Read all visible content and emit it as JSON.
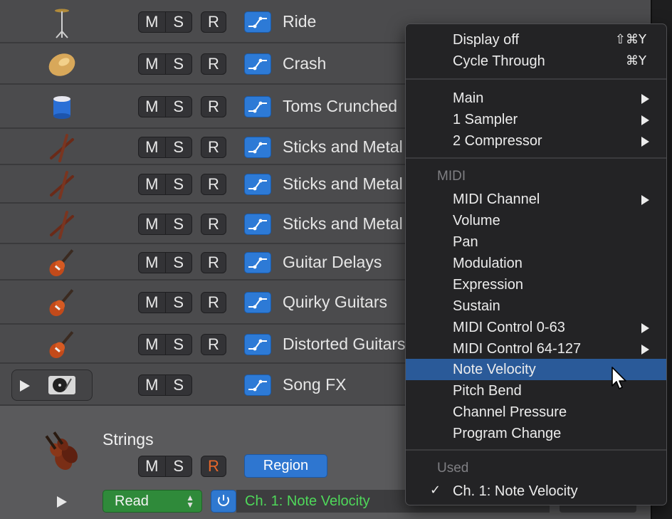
{
  "tracks": [
    {
      "name": "Ride",
      "icon": "cymbal-stand-icon",
      "mute": "M",
      "solo": "S",
      "record": "R"
    },
    {
      "name": "Crash",
      "icon": "crash-cymbal-icon",
      "mute": "M",
      "solo": "S",
      "record": "R"
    },
    {
      "name": "Toms Crunched",
      "icon": "tom-drum-icon",
      "mute": "M",
      "solo": "S",
      "record": "R"
    },
    {
      "name": "Sticks and Metal",
      "icon": "drumsticks-icon",
      "mute": "M",
      "solo": "S",
      "record": "R"
    },
    {
      "name": "Sticks and Metal",
      "icon": "drumsticks-icon",
      "mute": "M",
      "solo": "S",
      "record": "R"
    },
    {
      "name": "Sticks and Metal",
      "icon": "drumsticks-icon",
      "mute": "M",
      "solo": "S",
      "record": "R"
    },
    {
      "name": "Guitar Delays",
      "icon": "electric-guitar-icon",
      "mute": "M",
      "solo": "S",
      "record": "R"
    },
    {
      "name": "Quirky Guitars",
      "icon": "electric-guitar-icon",
      "mute": "M",
      "solo": "S",
      "record": "R"
    },
    {
      "name": "Distorted Guitars",
      "icon": "electric-guitar-icon",
      "mute": "M",
      "solo": "S",
      "record": "R"
    },
    {
      "name": "Song FX",
      "icon": "turntable-icon",
      "mute": "M",
      "solo": "S"
    }
  ],
  "selected_track": {
    "name": "Strings",
    "icon": "violin-icon",
    "mute": "M",
    "solo": "S",
    "record": "R",
    "region_button": "Region",
    "automation_mode": "Read",
    "automation_param": "Ch. 1: Note Velocity"
  },
  "menu": {
    "items": [
      {
        "label": "Display off",
        "shortcut": "⇧⌘Y"
      },
      {
        "label": "Cycle Through",
        "shortcut": "⌘Y"
      },
      {
        "label": "Main",
        "submenu": true
      },
      {
        "label": "1 Sampler",
        "submenu": true
      },
      {
        "label": "2 Compressor",
        "submenu": true
      },
      {
        "label": "MIDI Channel",
        "submenu": true
      },
      {
        "label": "Volume"
      },
      {
        "label": "Pan"
      },
      {
        "label": "Modulation"
      },
      {
        "label": "Expression"
      },
      {
        "label": "Sustain"
      },
      {
        "label": "MIDI Control 0-63",
        "submenu": true
      },
      {
        "label": "MIDI Control 64-127",
        "submenu": true
      },
      {
        "label": "Note Velocity",
        "highlighted": true
      },
      {
        "label": "Pitch Bend"
      },
      {
        "label": "Channel Pressure"
      },
      {
        "label": "Program Change"
      },
      {
        "label": "Ch. 1: Note Velocity",
        "checked": true
      }
    ],
    "section_midi": "MIDI",
    "section_used": "Used",
    "check_mark": "✓"
  },
  "colors": {
    "accent_blue": "#2d7ad6",
    "read_green": "#2f8a3a",
    "record_orange": "#e8672a",
    "menu_highlight": "#2a5a99",
    "param_green_text": "#4fd85a"
  }
}
